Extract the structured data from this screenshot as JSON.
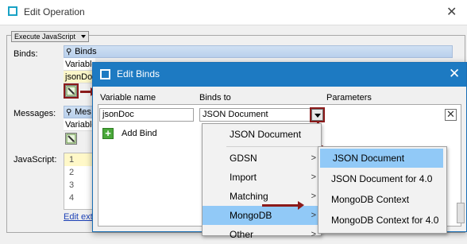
{
  "back_window": {
    "title": "Edit Operation",
    "close_glyph": "✕",
    "script_type": "Execute JavaScript",
    "binds_label": "Binds:",
    "binds_header": "Binds",
    "binds_col": "Variable",
    "binds_value": "jsonDoc",
    "messages_label": "Messages:",
    "messages_header": "Mes",
    "messages_col": "Variable",
    "javascript_label": "JavaScript:",
    "line_numbers": [
      "1",
      "2",
      "3",
      "4"
    ],
    "edit_link": "Edit ext"
  },
  "dialog": {
    "title": "Edit Binds",
    "close_glyph": "✕",
    "col_variable": "Variable name",
    "col_binds_to": "Binds to",
    "col_parameters": "Parameters",
    "variable_value": "jsonDoc",
    "binds_to_value": "JSON Document",
    "add_bind_label": "Add Bind"
  },
  "menu": {
    "items": [
      "JSON Document",
      "GDSN",
      "Import",
      "Matching",
      "MongoDB",
      "Other"
    ],
    "selected": "MongoDB"
  },
  "submenu": {
    "items": [
      "JSON Document",
      "JSON Document for 4.0",
      "MongoDB Context",
      "MongoDB Context for 4.0"
    ],
    "selected": "JSON Document"
  },
  "colors": {
    "dialog_title_bg": "#1d7ac2",
    "highlight_bg": "#91c9f7",
    "callout_red": "#8b1a1a"
  },
  "icons": [
    "window-icon",
    "pin-icon",
    "edit-icon",
    "plus-icon",
    "delete-icon",
    "chevron-right-icon",
    "dropdown-arrow-icon"
  ]
}
